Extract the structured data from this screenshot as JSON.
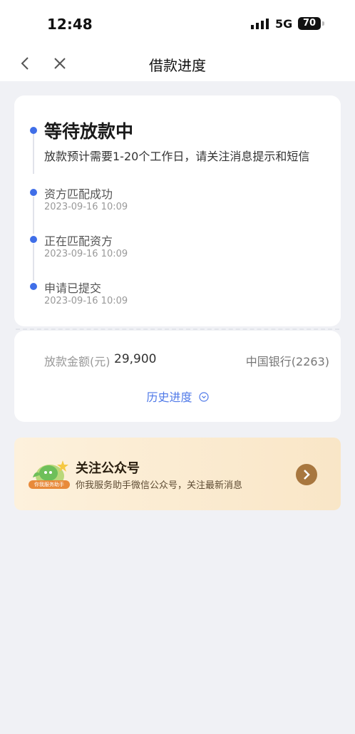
{
  "status": {
    "time": "12:48",
    "network": "5G",
    "battery": "70"
  },
  "nav": {
    "title": "借款进度"
  },
  "progress": {
    "current": {
      "title": "等待放款中",
      "desc": "放款预计需要1-20个工作日，请关注消息提示和短信"
    },
    "steps": [
      {
        "title": "资方匹配成功",
        "time": "2023-09-16 10:09"
      },
      {
        "title": "正在匹配资方",
        "time": "2023-09-16 10:09"
      },
      {
        "title": "申请已提交",
        "time": "2023-09-16 10:09"
      }
    ]
  },
  "loan": {
    "amount_label": "放款金额(元)",
    "amount_value": "29,900",
    "bank": "中国银行(2263)",
    "history_label": "历史进度"
  },
  "banner": {
    "badge": "你我服务助手",
    "title": "关注公众号",
    "desc": "你我服务助手微信公众号，关注最新消息"
  },
  "colors": {
    "accent": "#3f6ee8",
    "link": "#4f79e8",
    "banner_arrow": "#a8773f"
  }
}
